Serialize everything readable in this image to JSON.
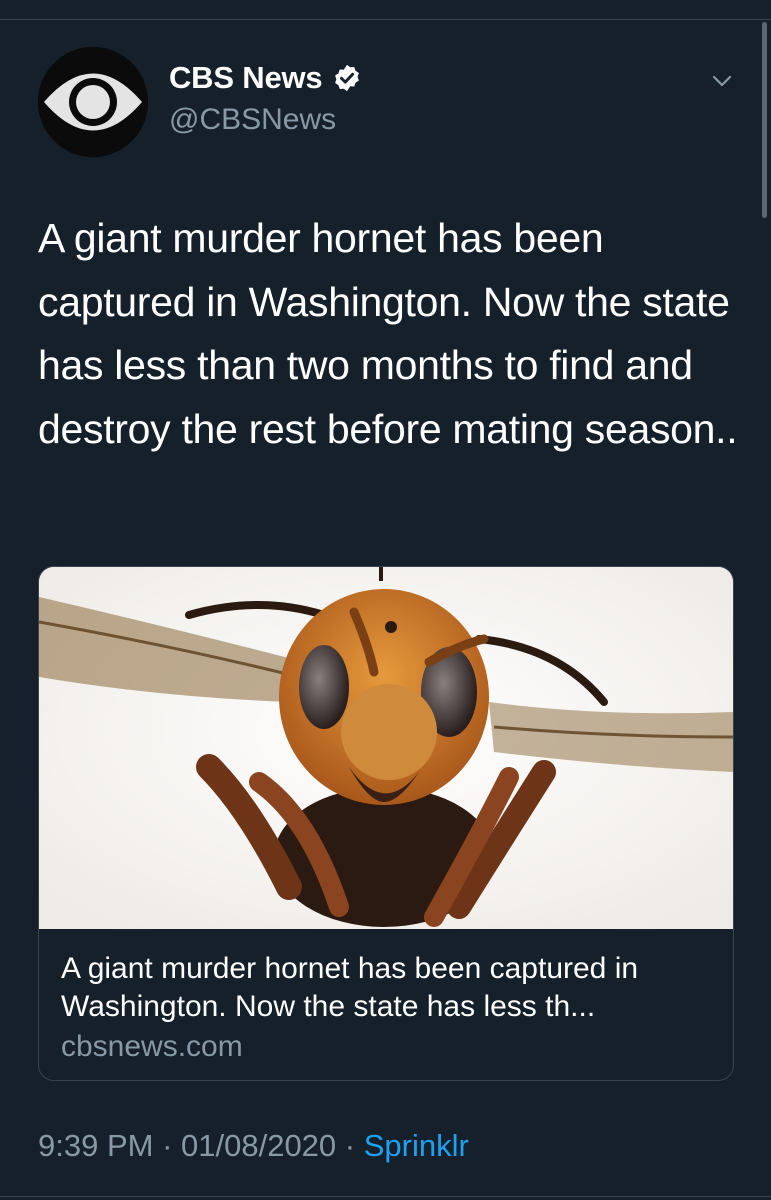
{
  "tweet": {
    "author_name": "CBS News",
    "author_handle": "@CBSNews",
    "text": "A giant murder hornet has been captured in Washington. Now the state has less than two months to find and destroy the rest before mating season..",
    "card": {
      "title": "A giant murder hornet has been captured in Washington. Now the state has less th...",
      "domain": "cbsnews.com"
    },
    "time": "9:39 PM",
    "date": "01/08/2020",
    "separator": " · ",
    "source": "Sprinklr"
  },
  "icons": {
    "avatar": "cbs-eye-logo",
    "verified": "verified-badge-icon",
    "menu": "chevron-down-icon"
  },
  "colors": {
    "background": "#15202b",
    "secondary_text": "#8899a6",
    "link": "#1da1f2",
    "border": "#38444d"
  }
}
